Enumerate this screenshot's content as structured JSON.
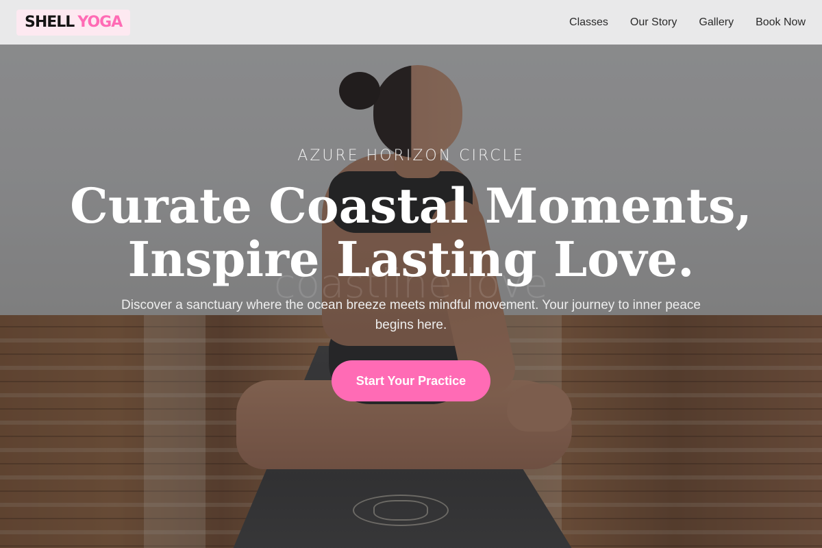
{
  "brand": {
    "name_part1": "SHELL",
    "name_part2": "YOGA"
  },
  "nav": {
    "items": [
      {
        "label": "Classes"
      },
      {
        "label": "Our Story"
      },
      {
        "label": "Gallery"
      },
      {
        "label": "Book Now"
      }
    ]
  },
  "hero": {
    "eyebrow": "AZURE HORIZON CIRCLE",
    "headline_line1": "Curate Coastal Moments,",
    "headline_line2": "Inspire Lasting Love.",
    "watermark": "coastline love",
    "subtext": "Discover a sanctuary where the ocean breeze meets mindful movement. Your journey to inner peace begins here.",
    "cta_label": "Start Your Practice"
  },
  "colors": {
    "accent": "#ff6bb5",
    "logo_bg": "#fde9f1",
    "header_bg": "#ececed",
    "text_light": "#ffffff"
  }
}
